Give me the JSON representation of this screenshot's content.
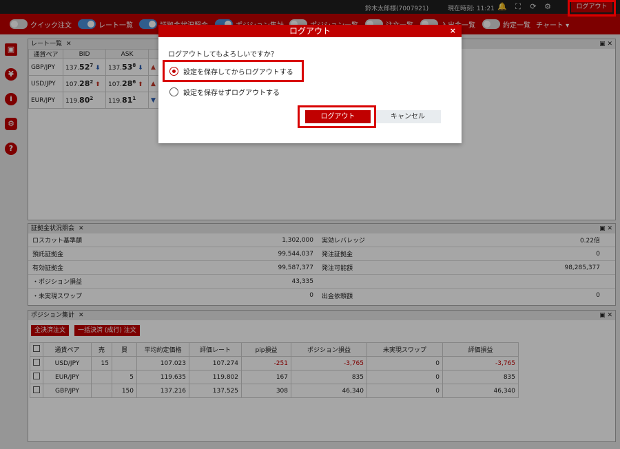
{
  "topbar": {
    "user": "鈴木太郎様(7007921)",
    "time": "現在時刻: 11:21",
    "logout_label": "ログアウト"
  },
  "nav": {
    "items": [
      {
        "label": "クイック注文",
        "on": false
      },
      {
        "label": "レート一覧",
        "on": true
      },
      {
        "label": "証拠金状況照会",
        "on": true
      },
      {
        "label": "ポジション集計",
        "on": true
      },
      {
        "label": "ポジション一覧",
        "on": false
      },
      {
        "label": "注文一覧",
        "on": false
      },
      {
        "label": "入出金一覧",
        "on": false
      },
      {
        "label": "約定一覧",
        "on": false
      }
    ],
    "chart_label": "チャート ▾"
  },
  "rate_panel": {
    "title": "レート一覧",
    "headers": [
      "通貨ペア",
      "BID",
      "ASK"
    ],
    "rows": [
      {
        "pair": "GBP/JPY",
        "bid_pre": "137.",
        "bid_big": "52",
        "bid_sup": "7",
        "bid_dir": "down",
        "ask_pre": "137.",
        "ask_big": "53",
        "ask_sup": "8",
        "ask_dir": "down",
        "extra_dir": "up"
      },
      {
        "pair": "USD/JPY",
        "bid_pre": "107.",
        "bid_big": "28",
        "bid_sup": "2",
        "bid_dir": "up",
        "ask_pre": "107.",
        "ask_big": "28",
        "ask_sup": "6",
        "ask_dir": "up",
        "extra_dir": "up"
      },
      {
        "pair": "EUR/JPY",
        "bid_pre": "119.",
        "bid_big": "80",
        "bid_sup": "2",
        "bid_dir": "",
        "ask_pre": "119.",
        "ask_big": "81",
        "ask_sup": "1",
        "ask_dir": "",
        "extra_dir": "down"
      }
    ]
  },
  "margin_panel": {
    "title": "証拠金状況照会",
    "rows": [
      {
        "l1": "ロスカット基準額",
        "v1": "1,302,000",
        "l2": "実効レバレッジ",
        "v2": "0.22倍"
      },
      {
        "l1": "預託証拠金",
        "v1": "99,544,037",
        "l2": "発注証拠金",
        "v2": "0"
      },
      {
        "l1": "有効証拠金",
        "v1": "99,587,377",
        "l2": "発注可能額",
        "v2": "98,285,377"
      },
      {
        "l1": "・ポジション損益",
        "v1": "43,335",
        "l2": "",
        "v2": ""
      },
      {
        "l1": "・未実現スワップ",
        "v1": "0",
        "l2": "出金依頼額",
        "v2": "0"
      }
    ]
  },
  "position_panel": {
    "title": "ポジション集計",
    "btn_all": "全決済注文",
    "btn_bulk": "一括決済 (成行) 注文",
    "headers": [
      "通貨ペア",
      "売",
      "買",
      "平均約定価格",
      "評価レート",
      "pip損益",
      "ポジション損益",
      "未実現スワップ",
      "評価損益"
    ],
    "rows": [
      {
        "pair": "USD/JPY",
        "sell": "15",
        "buy": "",
        "avg": "107.023",
        "rate": "107.274",
        "pip": "-251",
        "pl": "-3,765",
        "swap": "0",
        "eval": "-3,765"
      },
      {
        "pair": "EUR/JPY",
        "sell": "",
        "buy": "5",
        "avg": "119.635",
        "rate": "119.802",
        "pip": "167",
        "pl": "835",
        "swap": "0",
        "eval": "835"
      },
      {
        "pair": "GBP/JPY",
        "sell": "",
        "buy": "150",
        "avg": "137.216",
        "rate": "137.525",
        "pip": "308",
        "pl": "46,340",
        "swap": "0",
        "eval": "46,340"
      }
    ]
  },
  "dialog": {
    "title": "ログアウト",
    "close": "×",
    "question": "ログアウトしてもよろしいですか？",
    "opt_save": "設定を保存してからログアウトする",
    "opt_nosave": "設定を保存せずログアウトする",
    "ok_label": "ログアウト",
    "cancel_label": "キャンセル"
  },
  "colors": {
    "brand": "#c00000",
    "toggle_on": "#4a90d9"
  }
}
